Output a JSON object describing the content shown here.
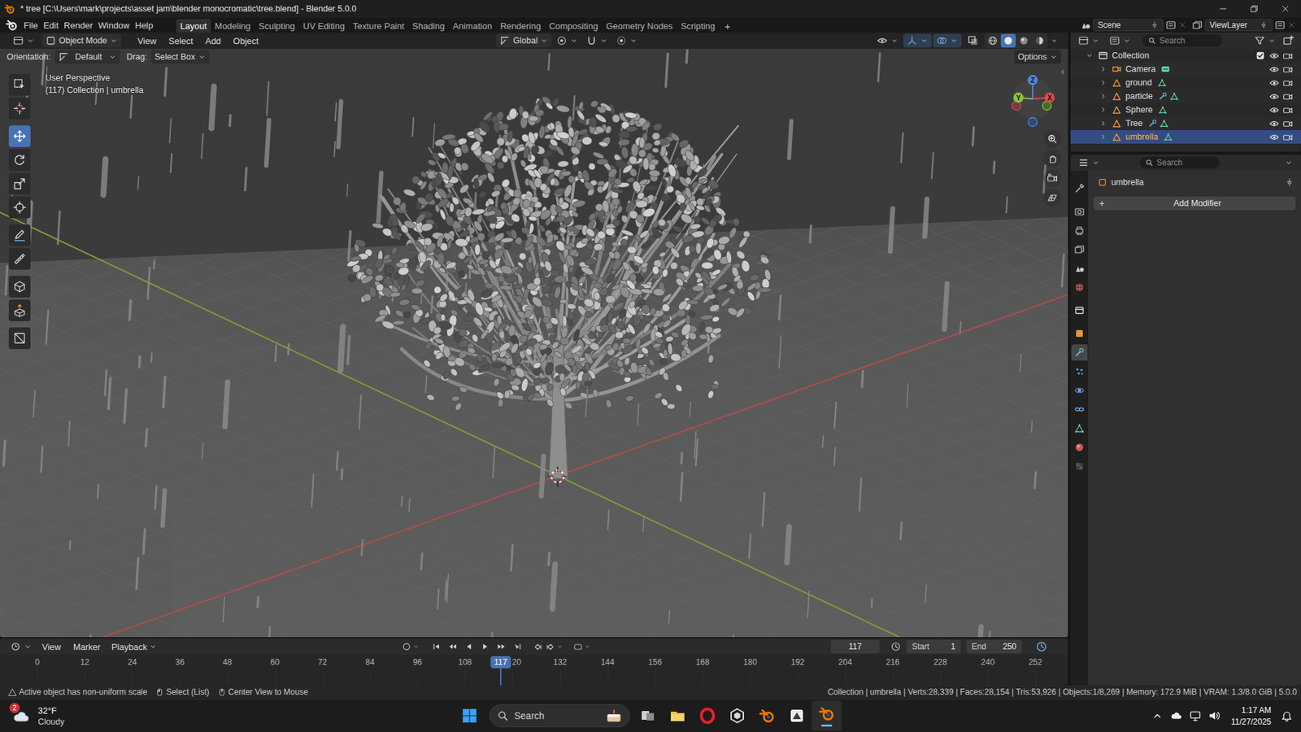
{
  "window": {
    "title": "* tree [C:\\Users\\mark\\projects\\asset jam\\blender monocromatic\\tree.blend] - Blender 5.0.0"
  },
  "menu": [
    "File",
    "Edit",
    "Render",
    "Window",
    "Help"
  ],
  "workspaces": [
    {
      "label": "Layout",
      "selected": true
    },
    {
      "label": "Modeling",
      "selected": false
    },
    {
      "label": "Sculpting",
      "selected": false
    },
    {
      "label": "UV Editing",
      "selected": false
    },
    {
      "label": "Texture Paint",
      "selected": false
    },
    {
      "label": "Shading",
      "selected": false
    },
    {
      "label": "Animation",
      "selected": false
    },
    {
      "label": "Rendering",
      "selected": false
    },
    {
      "label": "Compositing",
      "selected": false
    },
    {
      "label": "Geometry Nodes",
      "selected": false
    },
    {
      "label": "Scripting",
      "selected": false
    }
  ],
  "add_workspace": "+",
  "scene": "Scene",
  "view_layer": "ViewLayer",
  "viewport": {
    "mode": "Object Mode",
    "menus": [
      "View",
      "Select",
      "Add",
      "Object"
    ],
    "transform_orientation": "Global",
    "shading": [
      {
        "selected": false
      },
      {
        "selected": true
      },
      {
        "selected": false
      },
      {
        "selected": false
      }
    ],
    "tool_settings": {
      "orientation_label": "Orientation:",
      "orientation": "Default",
      "drag_label": "Drag:",
      "drag": "Select Box",
      "options": "Options"
    },
    "info": [
      "User Perspective",
      "(117) Collection | umbrella"
    ],
    "gizmo": {
      "x": "X",
      "y": "Y",
      "z": "Z"
    },
    "tools": [
      {
        "selected": false
      },
      {
        "selected": false
      },
      {
        "selected": true
      },
      {
        "selected": false
      },
      {
        "selected": false
      },
      {
        "selected": false
      },
      {
        "selected": false
      },
      {
        "selected": false
      },
      {
        "selected": false
      },
      {
        "selected": false
      },
      {
        "selected": false
      }
    ]
  },
  "outliner": {
    "search": "Search",
    "items": [
      {
        "name": "Collection",
        "kind": "collection",
        "expanded": true,
        "selected": false,
        "has_modifiers": false,
        "visible": true,
        "checked": true
      },
      {
        "name": "Camera",
        "kind": "camera",
        "expanded": false,
        "selected": false,
        "has_modifiers": false,
        "visible": true
      },
      {
        "name": "ground",
        "kind": "mesh",
        "expanded": false,
        "selected": false,
        "has_modifiers": false,
        "visible": true
      },
      {
        "name": "particle",
        "kind": "mesh",
        "expanded": false,
        "selected": false,
        "has_modifiers": true,
        "visible": true
      },
      {
        "name": "Sphere",
        "kind": "mesh",
        "expanded": false,
        "selected": false,
        "has_modifiers": false,
        "visible": true
      },
      {
        "name": "Tree",
        "kind": "mesh",
        "expanded": false,
        "selected": false,
        "has_modifiers": true,
        "visible": true
      },
      {
        "name": "umbrella",
        "kind": "mesh",
        "expanded": false,
        "selected": true,
        "has_modifiers": false,
        "visible": true
      }
    ]
  },
  "properties": {
    "search": "Search",
    "object": "umbrella",
    "add_modifier_icon": "+",
    "add_modifier": "Add Modifier",
    "tabs": [
      {
        "selected": false,
        "disabled": false
      },
      {
        "selected": false,
        "disabled": false
      },
      {
        "selected": false,
        "disabled": false
      },
      {
        "selected": false,
        "disabled": false
      },
      {
        "selected": false,
        "disabled": false
      },
      {
        "selected": false,
        "disabled": false
      },
      {
        "selected": false,
        "disabled": false
      },
      {
        "selected": false,
        "disabled": false
      },
      {
        "selected": true,
        "disabled": false
      },
      {
        "selected": false,
        "disabled": false
      },
      {
        "selected": false,
        "disabled": false
      },
      {
        "selected": false,
        "disabled": false
      },
      {
        "selected": false,
        "disabled": false
      },
      {
        "selected": false,
        "disabled": false
      },
      {
        "selected": false,
        "disabled": true
      }
    ]
  },
  "timeline": {
    "menus": [
      "View",
      "Marker",
      "Playback"
    ],
    "frame": "117",
    "start_label": "Start",
    "start": "1",
    "end_label": "End",
    "end": "250",
    "ticks": [
      "0",
      "12",
      "24",
      "36",
      "48",
      "60",
      "72",
      "84",
      "96",
      "108",
      "20",
      "132",
      "144",
      "156",
      "168",
      "180",
      "192",
      "204",
      "216",
      "228",
      "240",
      "252"
    ],
    "playhead": "117"
  },
  "status_bar": {
    "hints": [
      "Active object has non-uniform scale",
      "Select (List)",
      "Center View to Mouse"
    ],
    "stats": "Collection | umbrella | Verts:28,339 | Faces:28,154 | Tris:53,926 | Objects:1/8,269 | Memory: 172.9 MiB | VRAM: 1.3/8.0 GiB | 5.0.0"
  },
  "taskbar": {
    "weather": {
      "temp": "32°F",
      "condition": "Cloudy",
      "badge": "2"
    },
    "search": "Search",
    "time": "1:17 AM",
    "date": "11/27/2025"
  }
}
